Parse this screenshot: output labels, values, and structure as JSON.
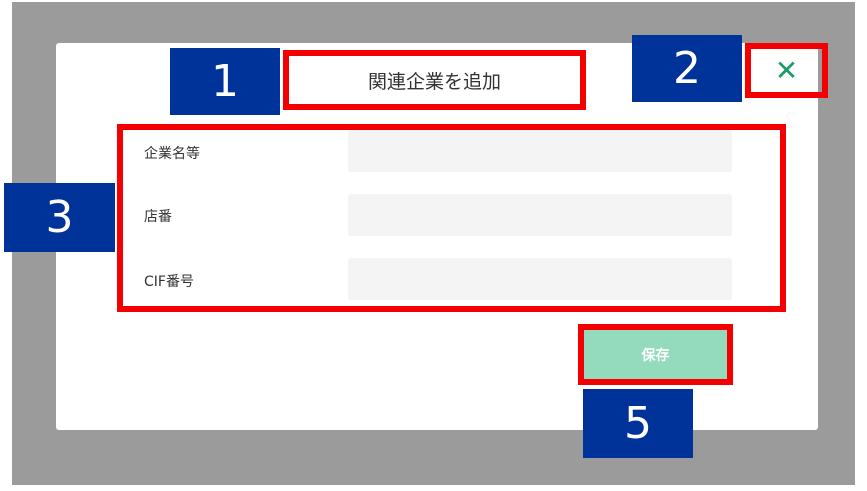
{
  "dialog": {
    "title": "関連企業を追加",
    "close_icon": "close-icon",
    "close_glyph": "✕",
    "fields": [
      {
        "label": "企業名等",
        "value": ""
      },
      {
        "label": "店番",
        "value": ""
      },
      {
        "label": "CIF番号",
        "value": ""
      }
    ],
    "save_label": "保存"
  },
  "annotations": {
    "badge1": "1",
    "badge2": "2",
    "badge3": "3",
    "badge5": "5"
  },
  "colors": {
    "overlay": "#9b9b9b",
    "highlight_border": "#f40000",
    "badge_bg": "#003399",
    "close_icon": "#1a9c68",
    "save_button": "#94dabd",
    "input_bg": "#f4f4f4"
  }
}
